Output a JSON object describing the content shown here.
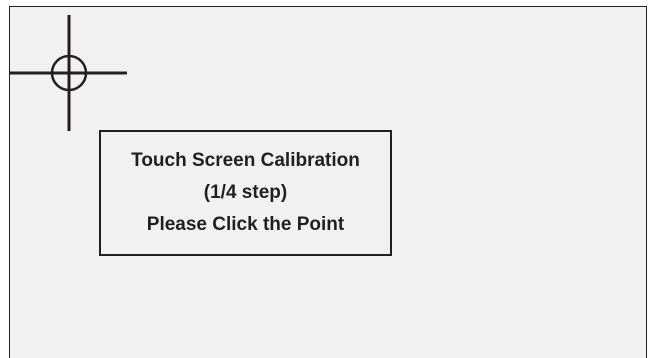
{
  "calibration": {
    "title": "Touch Screen Calibration",
    "step": "(1/4 step)",
    "instruction": "Please Click the Point",
    "current_step": 1,
    "total_steps": 4,
    "target_corner": "top-left"
  },
  "colors": {
    "screen_background": "#f1f1f1",
    "ink": "#231f20"
  },
  "icons": {
    "target": "crosshair-target-icon"
  }
}
